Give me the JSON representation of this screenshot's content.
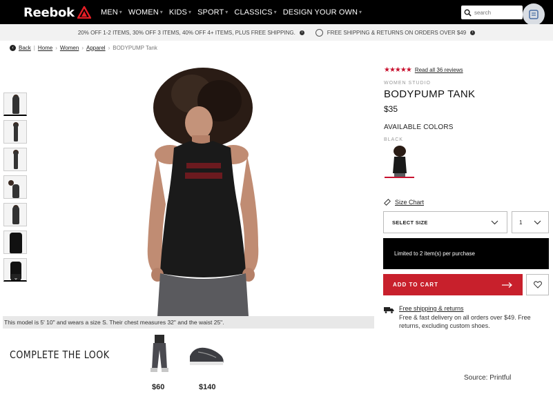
{
  "brand": {
    "name": "Reebok"
  },
  "nav": {
    "items": [
      {
        "label": "MEN"
      },
      {
        "label": "WOMEN"
      },
      {
        "label": "KIDS"
      },
      {
        "label": "SPORT"
      },
      {
        "label": "CLASSICS"
      },
      {
        "label": "DESIGN YOUR OWN"
      }
    ],
    "search_placeholder": "search"
  },
  "promo": {
    "offer": "20% OFF 1-2 ITEMS, 30% OFF 3 ITEMS, 40% OFF 4+ ITEMS, PLUS FREE SHIPPING.",
    "shipping": "FREE SHIPPING & RETURNS ON ORDERS OVER $49"
  },
  "breadcrumb": {
    "back": "Back",
    "items": [
      "Home",
      "Women",
      "Apparel"
    ],
    "current": "BODYPUMP Tank"
  },
  "gallery": {
    "caption": "This model is 5' 10\" and wears a size S. Their chest measures 32\" and the waist 25\"."
  },
  "product": {
    "rating": 4.5,
    "reviews_link": "Read all 36 reviews",
    "category": "WOMEN STUDIO",
    "title": "BODYPUMP TANK",
    "price": "$35",
    "available_colors_label": "AVAILABLE COLORS",
    "color_name": "BLACK",
    "size_chart": "Size Chart",
    "select_size": "SELECT SIZE",
    "quantity": "1",
    "limit_note": "Limited to 2 item(s) per purchase",
    "add_to_cart": "ADD TO CART",
    "shipping_link": "Free shipping & returns",
    "shipping_desc": "Free & fast delivery on all orders over $49. Free returns, excluding custom shoes."
  },
  "complete_the_look": {
    "title": "COMPLETE THE LOOK",
    "items": [
      {
        "price": "$60"
      },
      {
        "price": "$140"
      }
    ]
  },
  "source_note": "Source: Printful",
  "colors": {
    "accent": "#c8202c",
    "nav_bg": "#000000",
    "star": "#c8102e"
  }
}
